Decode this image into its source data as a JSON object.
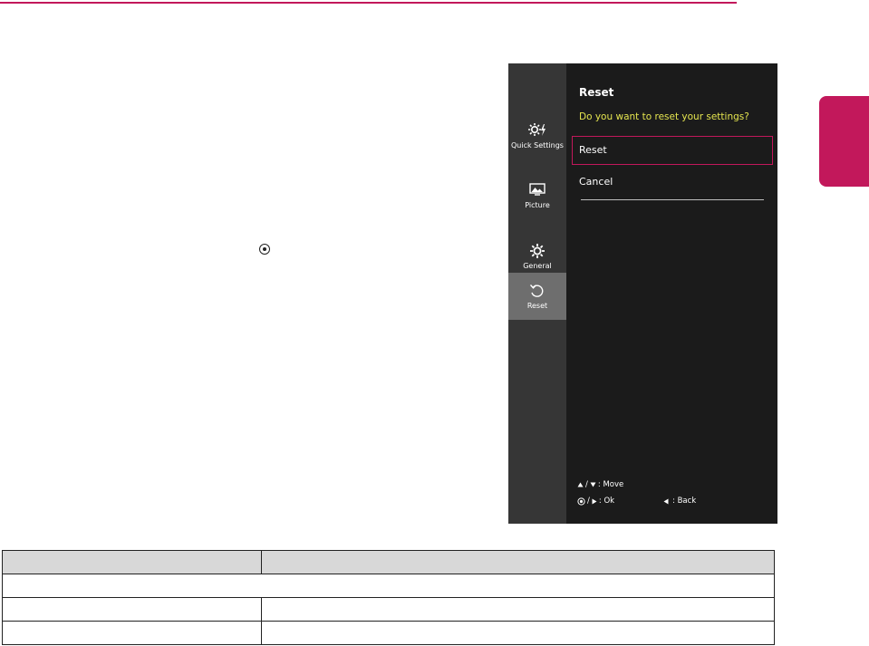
{
  "osd": {
    "sidebar": [
      {
        "label": "Quick Settings",
        "icon": "quick-settings-icon"
      },
      {
        "label": "Picture",
        "icon": "picture-icon"
      },
      {
        "label": "General",
        "icon": "gear-icon"
      },
      {
        "label": "Reset",
        "icon": "reset-icon",
        "active": true
      }
    ],
    "title": "Reset",
    "question": "Do you want to reset your settings?",
    "options": [
      "Reset",
      "Cancel"
    ],
    "help": {
      "move_keys": "/",
      "move": ": Move",
      "ok_keys": "/",
      "ok": ": Ok",
      "back": ": Back"
    }
  },
  "colors": {
    "accent": "#c2185b",
    "question": "#e5e54f",
    "panel": "#1b1b1b",
    "sidebar": "#363636",
    "active": "#6e6e6e"
  }
}
